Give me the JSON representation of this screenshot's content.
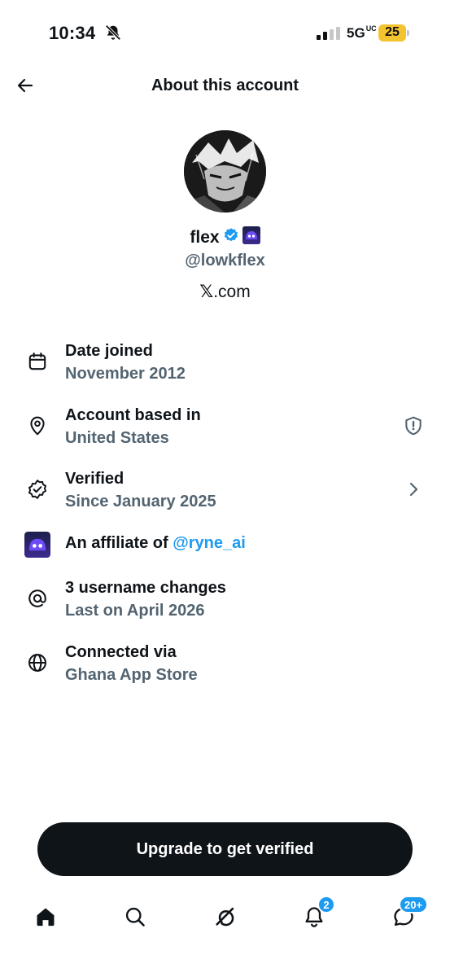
{
  "status_bar": {
    "time": "10:34",
    "network": "5G",
    "network_suffix": "UC",
    "battery_level": "25",
    "battery_color": "#f4c430"
  },
  "header": {
    "title": "About this account",
    "back_icon": "arrow-left-icon"
  },
  "profile": {
    "name": "flex",
    "handle": "@lowkflex",
    "domain_suffix": ".com",
    "domain_logo": "𝕏",
    "verified_color": "#1d9bf0"
  },
  "details": [
    {
      "icon": "calendar-icon",
      "title": "Date joined",
      "value": "November 2012"
    },
    {
      "icon": "location-pin-icon",
      "title": "Account based in",
      "value": "United States",
      "right_icon": "shield-alert-icon"
    },
    {
      "icon": "verified-badge-icon",
      "title": "Verified",
      "value": "Since January 2025",
      "right_icon": "chevron-right-icon"
    },
    {
      "icon": "affiliate-logo-icon",
      "title": "An affiliate of",
      "link": "@ryne_ai"
    },
    {
      "icon": "at-sign-icon",
      "title": "3 username changes",
      "value": "Last on April 2026"
    },
    {
      "icon": "globe-icon",
      "title": "Connected via",
      "value": "Ghana App Store"
    }
  ],
  "cta": {
    "label": "Upgrade to get verified"
  },
  "bottom_nav": {
    "items": [
      "home-icon",
      "search-icon",
      "grok-icon",
      "notifications-icon",
      "messages-icon"
    ],
    "notifications_badge": "2",
    "messages_badge": "20+",
    "accent": "#1d9bf0"
  }
}
